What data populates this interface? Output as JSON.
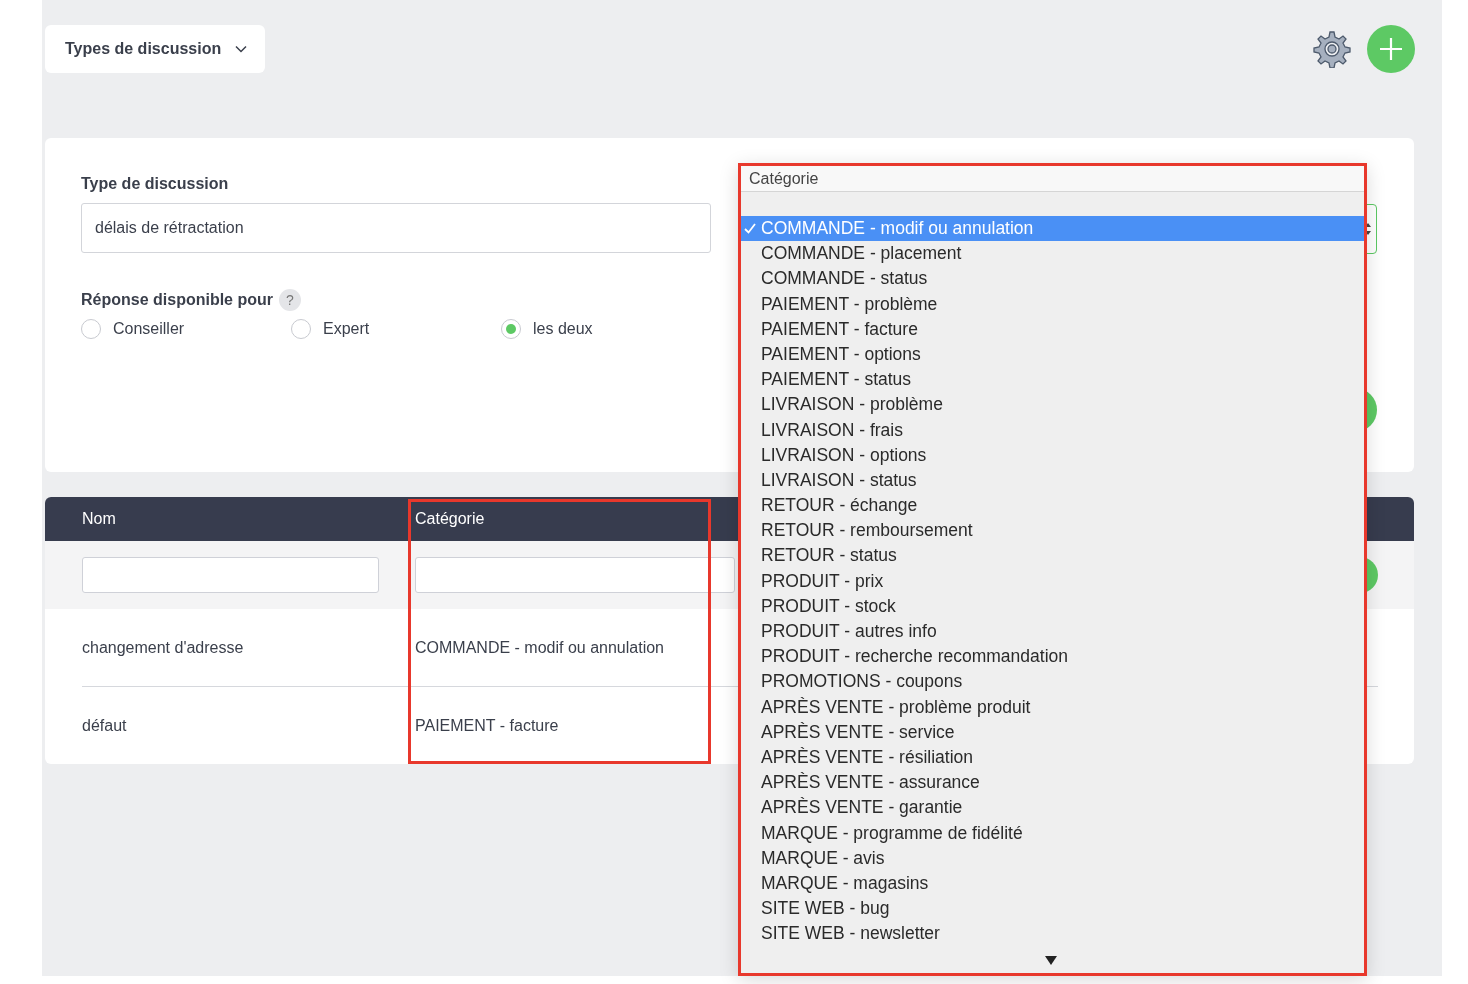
{
  "toolbar": {
    "view_menu": "Types de discussion"
  },
  "form": {
    "name_label": "Type de discussion",
    "name_value": "délais de rétractation",
    "category_label": "Catégorie",
    "availability_label": "Réponse disponible pour",
    "help": "?",
    "options": [
      {
        "label": "Conseiller",
        "selected": false
      },
      {
        "label": "Expert",
        "selected": false
      },
      {
        "label": "les deux",
        "selected": true
      }
    ]
  },
  "table": {
    "columns": [
      "Nom",
      "Catégorie"
    ],
    "rows": [
      [
        "changement d'adresse",
        "COMMANDE - modif ou annulation"
      ],
      [
        "défaut",
        "PAIEMENT - facture"
      ]
    ]
  },
  "category_menu": {
    "items": [
      {
        "label": "COMMANDE - modif ou annulation",
        "selected": true
      },
      {
        "label": "COMMANDE - placement",
        "selected": false
      },
      {
        "label": "COMMANDE - status",
        "selected": false
      },
      {
        "label": "PAIEMENT - problème",
        "selected": false
      },
      {
        "label": "PAIEMENT - facture",
        "selected": false
      },
      {
        "label": "PAIEMENT - options",
        "selected": false
      },
      {
        "label": "PAIEMENT - status",
        "selected": false
      },
      {
        "label": "LIVRAISON - problème",
        "selected": false
      },
      {
        "label": "LIVRAISON - frais",
        "selected": false
      },
      {
        "label": "LIVRAISON - options",
        "selected": false
      },
      {
        "label": "LIVRAISON - status",
        "selected": false
      },
      {
        "label": "RETOUR - échange",
        "selected": false
      },
      {
        "label": "RETOUR - remboursement",
        "selected": false
      },
      {
        "label": "RETOUR - status",
        "selected": false
      },
      {
        "label": "PRODUIT - prix",
        "selected": false
      },
      {
        "label": "PRODUIT - stock",
        "selected": false
      },
      {
        "label": "PRODUIT - autres info",
        "selected": false
      },
      {
        "label": "PRODUIT - recherche recommandation",
        "selected": false
      },
      {
        "label": "PROMOTIONS - coupons",
        "selected": false
      },
      {
        "label": "APRÈS VENTE - problème produit",
        "selected": false
      },
      {
        "label": "APRÈS VENTE - service",
        "selected": false
      },
      {
        "label": "APRÈS VENTE - résiliation",
        "selected": false
      },
      {
        "label": "APRÈS VENTE - assurance",
        "selected": false
      },
      {
        "label": "APRÈS VENTE - garantie",
        "selected": false
      },
      {
        "label": "MARQUE - programme de fidélité",
        "selected": false
      },
      {
        "label": "MARQUE - avis",
        "selected": false
      },
      {
        "label": "MARQUE - magasins",
        "selected": false
      },
      {
        "label": "SITE WEB - bug",
        "selected": false
      },
      {
        "label": "SITE WEB - newsletter",
        "selected": false
      }
    ]
  }
}
